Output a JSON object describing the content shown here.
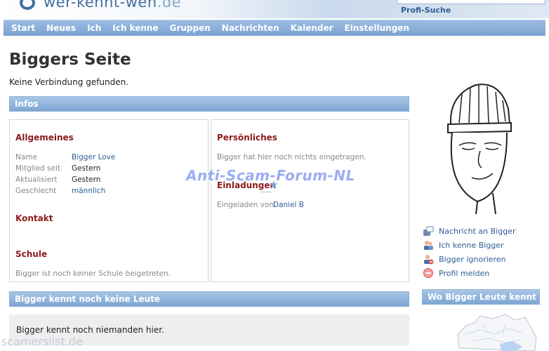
{
  "header": {
    "logo_text": "wer-kennt-wen",
    "logo_tld": ".de",
    "profi_suche": "Profi-Suche"
  },
  "nav": [
    "Start",
    "Neues",
    "Ich",
    "Ich kenne",
    "Gruppen",
    "Nachrichten",
    "Kalender",
    "Einstellungen"
  ],
  "page": {
    "title": "Biggers Seite",
    "status": "Keine Verbindung gefunden."
  },
  "infos": {
    "bar_title": "Infos",
    "allgemeines": {
      "heading": "Allgemeines",
      "rows": [
        {
          "label": "Name",
          "value": "Bigger Love"
        },
        {
          "label": "Mitglied seit",
          "value": "Gestern"
        },
        {
          "label": "Aktualisiert",
          "value": "Gestern"
        },
        {
          "label": "Geschlecht",
          "value": "männlich"
        }
      ]
    },
    "kontakt": {
      "heading": "Kontakt"
    },
    "schule": {
      "heading": "Schule",
      "text": "Bigger ist noch keiner Schule beigetreten."
    },
    "persoenliches": {
      "heading": "Persönliches",
      "text": "Bigger hat hier noch nichts eingetragen."
    },
    "einladungen": {
      "heading": "Einladungen",
      "label": "Eingeladen von",
      "value": "Daniel B"
    }
  },
  "people": {
    "bar_title": "Bigger kennt noch keine Leute",
    "text": "Bigger kennt noch niemanden hier."
  },
  "actions": [
    {
      "label": "Nachricht an Bigger",
      "icon": "message-icon"
    },
    {
      "label": "Ich kenne Bigger",
      "icon": "add-friend-icon"
    },
    {
      "label": "Bigger ignorieren",
      "icon": "ignore-user-icon"
    },
    {
      "label": "Profil melden",
      "icon": "report-icon"
    }
  ],
  "where_known": {
    "bar_title": "Wo Bigger Leute kennt"
  },
  "watermarks": {
    "main": "Anti-Scam-Forum-NL",
    "corner": "scamerslist.de"
  },
  "colors": {
    "nav_blue": "#7aa2d2",
    "heading_red": "#8b1a1a",
    "link_blue": "#2d5e95"
  }
}
